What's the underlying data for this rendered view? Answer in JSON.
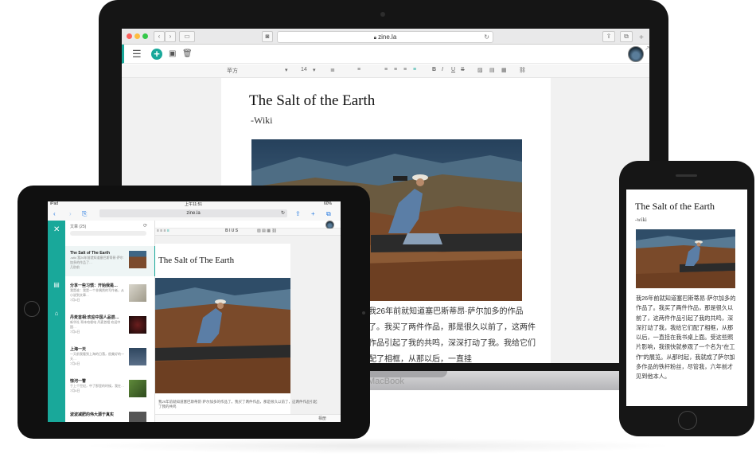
{
  "mac": {
    "brand_label": "MacBook",
    "safari": {
      "url": "zine.la"
    },
    "format_toolbar": {
      "font": "苹方",
      "size": "14"
    },
    "document": {
      "title": "The Salt of the Earth",
      "subtitle": "-Wiki",
      "body": "我26年前就知道塞巴斯蒂昂·萨尔加多的作品了。我买了两件作品，那是很久以前了，这两件作品引起了我的共鸣，深深打动了我。我给它们配了相框，从那以后，一直挂"
    }
  },
  "ipad": {
    "status": {
      "carrier": "iPad",
      "time": "上午11:51",
      "battery": "60%"
    },
    "url": "zine.la",
    "list_header": "文章 (25)",
    "articles": [
      {
        "title": "The Salt of The Earth",
        "text": "-wiki 我26年前就知道塞巴斯蒂昂·萨尔加多的作品了…",
        "date": "几秒前"
      },
      {
        "title": "分享一些习惯：开始我是…",
        "text": "我是谁：我是一个非偶然的写作者，从小说到文章…",
        "date": "7月4日"
      },
      {
        "title": "丹麦首相:欢迎中国人品尝…",
        "text": "新华社 哥本哈根电 丹麦首相 欢迎中国…",
        "date": "7月4日"
      },
      {
        "title": "上海一天",
        "text": "一天前我看到上海的日落，很美好的一天…",
        "date": "7月4日"
      },
      {
        "title": "惊河一瞥",
        "text": "于上个世纪，中了那里的时候，我在…",
        "date": "7月4日"
      },
      {
        "title": "波波减肥的伟大源于真实",
        "text": "",
        "date": ""
      }
    ],
    "document": {
      "title": "The Salt of The Earth",
      "body": "我26年前就知道塞巴斯蒂昂·萨尔加多的作品了。我买了两件作品，那是很久以前了，这两件作品引起了我的共鸣",
      "bottom_status": "相册"
    }
  },
  "iphone": {
    "document": {
      "title": "The Salt of the Earth",
      "subtitle": "-wiki",
      "body": "我26年前就知道塞巴斯蒂昂·萨尔加多的作品了。我买了两件作品，那是很久以前了，这两件作品引起了我的共鸣，深深打动了我，我给它们配了相框，从那以后，一直挂在我书桌上面。受这些照片影响，我很快就参观了一个名为“在工作”的展览。从那时起，我就成了萨尔加多作品的铁杆粉丝，尽管我，六年前才见到他本人。"
    }
  },
  "colors": {
    "accent": "#19a89a",
    "device": "#151515",
    "page": "#ffffff"
  },
  "icons": [
    "hamburger-icon",
    "add-icon",
    "save-icon",
    "trash-icon",
    "back-icon",
    "forward-icon",
    "share-icon",
    "tabs-icon",
    "close-icon",
    "article-icon",
    "tag-icon",
    "reload-icon",
    "lock-icon",
    "bookmarks-icon"
  ]
}
